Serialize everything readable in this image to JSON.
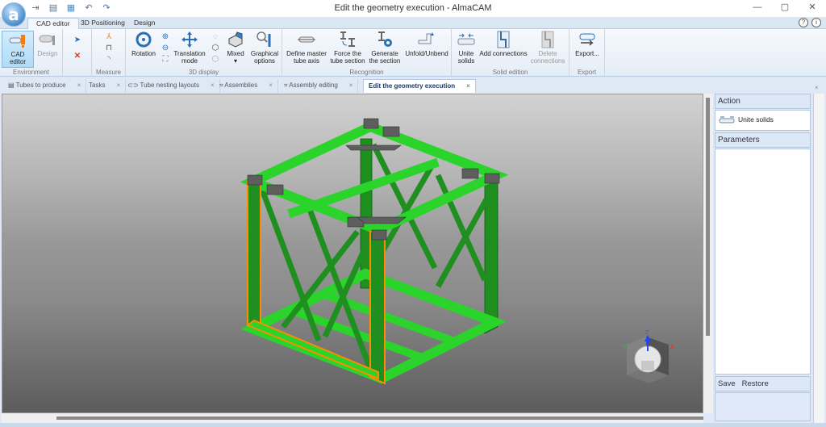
{
  "window": {
    "title": "Edit the geometry execution - AlmaCAM",
    "logo_glyph": "a",
    "controls": [
      "—",
      "▢",
      "✕"
    ]
  },
  "quick_access": [
    "⇥",
    "💾",
    "▦",
    "↶",
    "↷"
  ],
  "ribbon_tabs": [
    {
      "label": "CAD editor",
      "active": true
    },
    {
      "label": "3D Positioning"
    },
    {
      "label": "Design"
    }
  ],
  "help_icons": [
    "?",
    "i"
  ],
  "ribbon": {
    "environment": {
      "label": "Environment",
      "buttons": [
        "CAD editor",
        "Design"
      ]
    },
    "measure": {
      "label": "Measure"
    },
    "display3d": {
      "label": "3D display",
      "buttons": [
        "Rotation",
        "Translation mode",
        "Mixed",
        "Graphical options"
      ]
    },
    "recognition": {
      "label": "Recognition",
      "buttons": [
        "Define master tube axis",
        "Force the tube section",
        "Generate the section",
        "Unfold/Unbend"
      ]
    },
    "solid_edition": {
      "label": "Solid edition",
      "buttons": [
        "Unite solids",
        "Add connections",
        "Delete connections"
      ]
    },
    "export": {
      "label": "Export",
      "buttons": [
        "Export..."
      ]
    }
  },
  "doc_tabs": [
    {
      "label": "Tubes to produce"
    },
    {
      "label": "Tasks"
    },
    {
      "label": "Tube nesting layouts"
    },
    {
      "label": "Assemblies"
    },
    {
      "label": "Assembly editing"
    },
    {
      "label": "Edit the geometry execution",
      "active": true
    }
  ],
  "right_panel": {
    "action_header": "Action",
    "action_item": "Unite solids",
    "parameters_header": "Parameters",
    "save": "Save",
    "restore": "Restore"
  },
  "view_cube": {
    "axes": [
      "Z",
      "Y",
      "X"
    ]
  },
  "colors": {
    "structure": "#22b822",
    "structure_light": "#3fe03f",
    "selected": "#ff8c00",
    "plates": "#6a6a6a"
  }
}
